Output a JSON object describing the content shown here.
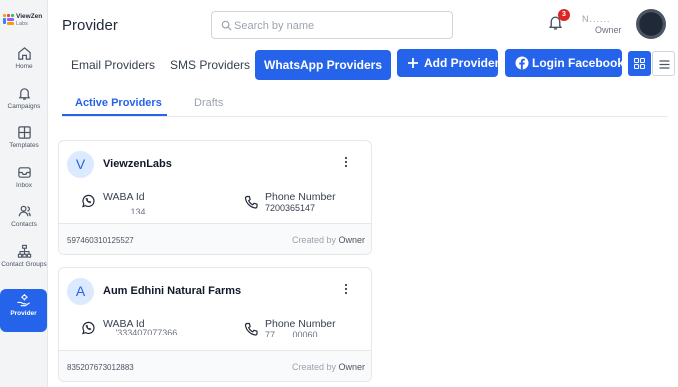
{
  "brand": {
    "name": "ViewZen",
    "sub": "Labs"
  },
  "sidebar": {
    "items": [
      {
        "label": "Home",
        "icon": "home-icon"
      },
      {
        "label": "Campaigns",
        "icon": "bell-icon"
      },
      {
        "label": "Templates",
        "icon": "grid-icon"
      },
      {
        "label": "Inbox",
        "icon": "inbox-icon"
      },
      {
        "label": "Contacts",
        "icon": "users-icon"
      },
      {
        "label": "Contact Groups",
        "icon": "sitemap-icon"
      },
      {
        "label": "Provider",
        "icon": "hand-gear-icon",
        "active": true
      }
    ]
  },
  "header": {
    "title": "Provider",
    "search_placeholder": "Search by name",
    "notification_count": "3",
    "user_name": "N......",
    "user_role": "Owner"
  },
  "provider_tabs": [
    {
      "label": "Email Providers"
    },
    {
      "label": "SMS Providers"
    },
    {
      "label": "WhatsApp Providers",
      "active": true
    }
  ],
  "actions": {
    "add_provider": "Add Provider",
    "login_facebook": "Login Facebook"
  },
  "status_tabs": [
    {
      "label": "Active Providers",
      "active": true
    },
    {
      "label": "Drafts"
    }
  ],
  "cards": [
    {
      "initial": "V",
      "name": "ViewzenLabs",
      "waba_label": "WABA Id",
      "waba_value": "...........134........",
      "phone_label": "Phone Number",
      "phone_value": "7200365147",
      "footer_id": "597460310125527",
      "created_by_prefix": "Created by",
      "created_by": "Owner"
    },
    {
      "initial": "A",
      "name": "Aum Edhini Natural Farms",
      "waba_label": "WABA Id",
      "waba_value": ".....'333407077366",
      "phone_label": "Phone Number",
      "phone_value": "77.......00060",
      "footer_id": "835207673012883",
      "created_by_prefix": "Created by",
      "created_by": "Owner"
    }
  ],
  "colors": {
    "accent": "#2563eb",
    "badge": "#dc2626",
    "whatsapp_green": "#1f2937"
  }
}
